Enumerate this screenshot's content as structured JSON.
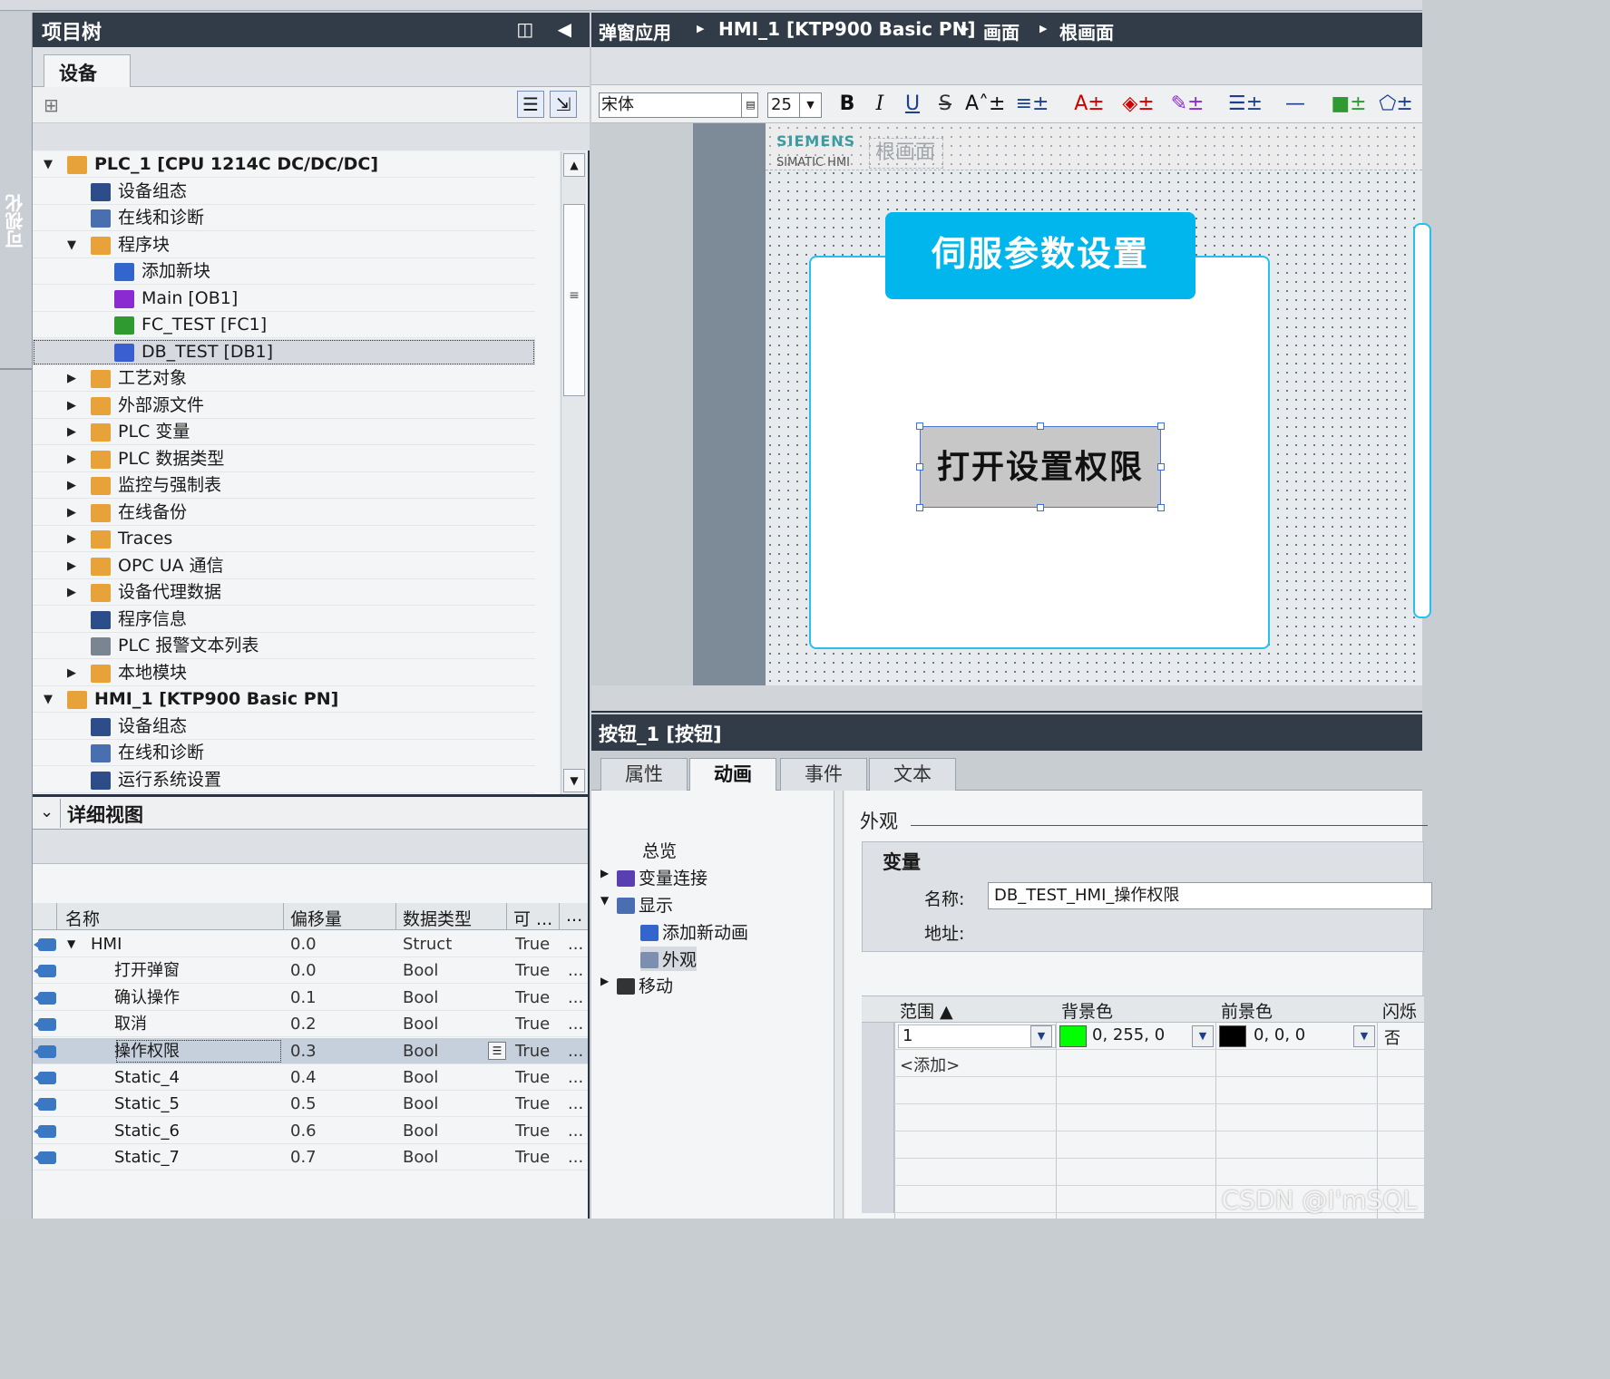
{
  "side_tab": {
    "label": "可视化"
  },
  "tree": {
    "title": "项目树",
    "header_icons": "◫ ◀",
    "tab_devices": "设备",
    "toolbar_left_icon": "folder-tree-icon",
    "toolbar_right_icons": [
      "list-view-icon",
      "table-export-icon"
    ],
    "items": [
      {
        "label": "PLC_1 [CPU 1214C DC/DC/DC]",
        "arrow": "▼",
        "icon": "plc-folder-icon",
        "color": "#e8a23a"
      },
      {
        "label": "设备组态",
        "arrow": "",
        "icon": "device-config-icon",
        "color": "#2c4d8a"
      },
      {
        "label": "在线和诊断",
        "arrow": "",
        "icon": "online-diag-icon",
        "color": "#4a6fb0"
      },
      {
        "label": "程序块",
        "arrow": "▼",
        "icon": "program-blocks-folder-icon",
        "color": "#e8a23a"
      },
      {
        "label": "添加新块",
        "arrow": "",
        "icon": "add-block-icon",
        "color": "#3366cc"
      },
      {
        "label": "Main [OB1]",
        "arrow": "",
        "icon": "ob-block-icon",
        "color": "#8a2ad0"
      },
      {
        "label": "FC_TEST [FC1]",
        "arrow": "",
        "icon": "fc-block-icon",
        "color": "#2f9a2f"
      },
      {
        "label": "DB_TEST [DB1]",
        "arrow": "",
        "icon": "db-block-icon",
        "color": "#3a5fd0"
      },
      {
        "label": "工艺对象",
        "arrow": "▶",
        "icon": "technology-objects-icon",
        "color": "#e8a23a"
      },
      {
        "label": "外部源文件",
        "arrow": "▶",
        "icon": "external-source-icon",
        "color": "#e8a23a"
      },
      {
        "label": "PLC 变量",
        "arrow": "▶",
        "icon": "plc-tags-icon",
        "color": "#e8a23a"
      },
      {
        "label": "PLC 数据类型",
        "arrow": "▶",
        "icon": "plc-datatypes-icon",
        "color": "#e8a23a"
      },
      {
        "label": "监控与强制表",
        "arrow": "▶",
        "icon": "watch-force-tables-icon",
        "color": "#e8a23a"
      },
      {
        "label": "在线备份",
        "arrow": "▶",
        "icon": "online-backup-icon",
        "color": "#e8a23a"
      },
      {
        "label": "Traces",
        "arrow": "▶",
        "icon": "traces-icon",
        "color": "#e8a23a"
      },
      {
        "label": "OPC UA 通信",
        "arrow": "▶",
        "icon": "opc-ua-icon",
        "color": "#e8a23a"
      },
      {
        "label": "设备代理数据",
        "arrow": "▶",
        "icon": "device-proxy-icon",
        "color": "#e8a23a"
      },
      {
        "label": "程序信息",
        "arrow": "",
        "icon": "program-info-icon",
        "color": "#2c4d8a"
      },
      {
        "label": "PLC 报警文本列表",
        "arrow": "",
        "icon": "alarm-text-list-icon",
        "color": "#7a8591"
      },
      {
        "label": "本地模块",
        "arrow": "▶",
        "icon": "local-modules-icon",
        "color": "#e8a23a"
      },
      {
        "label": "HMI_1 [KTP900 Basic PN]",
        "arrow": "▼",
        "icon": "hmi-folder-icon",
        "color": "#e8a23a"
      },
      {
        "label": "设备组态",
        "arrow": "",
        "icon": "device-config-icon",
        "color": "#2c4d8a"
      },
      {
        "label": "在线和诊断",
        "arrow": "",
        "icon": "online-diag-icon",
        "color": "#4a6fb0"
      },
      {
        "label": "运行系统设置",
        "arrow": "",
        "icon": "runtime-settings-icon",
        "color": "#2c4d8a"
      }
    ]
  },
  "detail": {
    "title": "详细视图",
    "columns": [
      "名称",
      "偏移量",
      "数据类型",
      "可 ...",
      "..."
    ],
    "rows": [
      {
        "name": "HMI",
        "arrow": "▼",
        "offset": "0.0",
        "type": "Struct",
        "access": "True",
        "more": "..."
      },
      {
        "name": "打开弹窗",
        "arrow": "",
        "offset": "0.0",
        "type": "Bool",
        "access": "True",
        "more": "..."
      },
      {
        "name": "确认操作",
        "arrow": "",
        "offset": "0.1",
        "type": "Bool",
        "access": "True",
        "more": "..."
      },
      {
        "name": "取消",
        "arrow": "",
        "offset": "0.2",
        "type": "Bool",
        "access": "True",
        "more": "..."
      },
      {
        "name": "操作权限",
        "arrow": "",
        "offset": "0.3",
        "type": "Bool",
        "access": "True",
        "more": "..."
      },
      {
        "name": "Static_4",
        "arrow": "",
        "offset": "0.4",
        "type": "Bool",
        "access": "True",
        "more": "..."
      },
      {
        "name": "Static_5",
        "arrow": "",
        "offset": "0.5",
        "type": "Bool",
        "access": "True",
        "more": "..."
      },
      {
        "name": "Static_6",
        "arrow": "",
        "offset": "0.6",
        "type": "Bool",
        "access": "True",
        "more": "..."
      },
      {
        "name": "Static_7",
        "arrow": "",
        "offset": "0.7",
        "type": "Bool",
        "access": "True",
        "more": "..."
      }
    ]
  },
  "breadcrumb": [
    "弹窗应用",
    "HMI_1 [KTP900 Basic PN]",
    "画面",
    "根画面"
  ],
  "format_bar": {
    "font": "宋体",
    "size": "25",
    "buttons": [
      "B",
      "I",
      "U",
      "S",
      "A˄±",
      "≡±",
      "A±",
      "◈±",
      "✎±",
      "☰±",
      "—±",
      "■±",
      "⬠±"
    ]
  },
  "hmi": {
    "logo": "SIEMENS",
    "model_label": "SIMATIC HMI",
    "screen_name": "根画面",
    "popup_title": "伺服参数设置",
    "button_text": "打开设置权限"
  },
  "inspector": {
    "title": "按钮_1 [按钮]",
    "tabs": [
      "属性",
      "动画",
      "事件",
      "文本"
    ],
    "active_tab": "动画",
    "nav": [
      {
        "label": "总览",
        "arrow": "",
        "icon": ""
      },
      {
        "label": "变量连接",
        "arrow": "▶",
        "icon": "tag-connection-icon"
      },
      {
        "label": "显示",
        "arrow": "▼",
        "icon": "display-icon"
      },
      {
        "label": "添加新动画",
        "arrow": "",
        "icon": "add-animation-icon"
      },
      {
        "label": "外观",
        "arrow": "",
        "icon": "appearance-icon"
      },
      {
        "label": "移动",
        "arrow": "▶",
        "icon": "movement-icon"
      }
    ],
    "section_label": "外观",
    "variable_group": "变量",
    "name_label": "名称:",
    "name_value": "DB_TEST_HMI_操作权限",
    "address_label": "地址:",
    "table": {
      "columns": [
        "范围 ▲",
        "背景色",
        "前景色",
        "闪烁"
      ],
      "rows": [
        {
          "range": "1",
          "bg": "0, 255, 0",
          "bg_color": "#00ff00",
          "fg": "0, 0, 0",
          "fg_color": "#000000",
          "flash": "否"
        }
      ],
      "add_label": "<添加>"
    }
  },
  "watermark": "CSDN @I'mSQL"
}
